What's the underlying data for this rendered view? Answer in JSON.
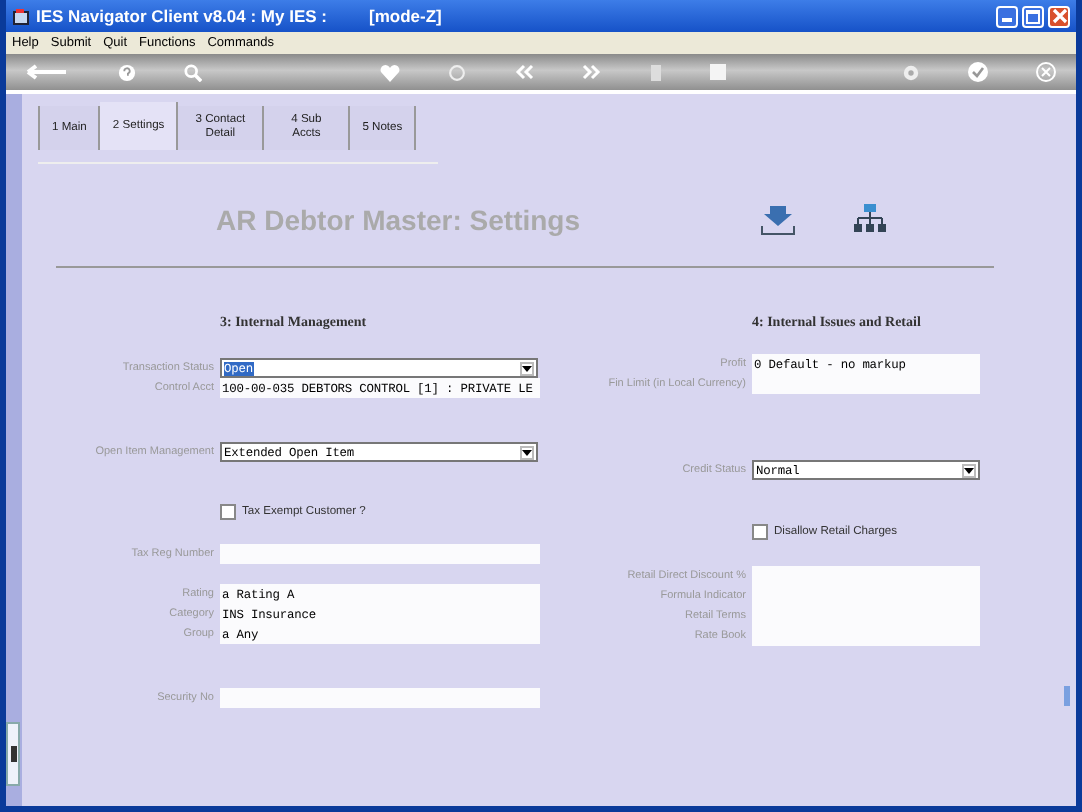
{
  "window": {
    "title": "IES Navigator Client v8.04 : My IES :",
    "mode": "[mode-Z]"
  },
  "menu": [
    "Help",
    "Submit",
    "Quit",
    "Functions",
    "Commands"
  ],
  "tabs": [
    {
      "label": "1 Main",
      "selected": false
    },
    {
      "label": "2 Settings",
      "selected": true
    },
    {
      "label": "3 Contact Detail",
      "selected": false
    },
    {
      "label": "4 Sub Accts",
      "selected": false
    },
    {
      "label": "5 Notes",
      "selected": false
    }
  ],
  "page_title": "AR Debtor Master: Settings",
  "sections": [
    {
      "heading": "3: Internal Management",
      "groups": [
        [
          {
            "kind": "select",
            "label": "Transaction Status",
            "value": "Open",
            "focused": true
          },
          {
            "kind": "text",
            "label": "Control Acct",
            "value": "100-00-035 DEBTORS CONTROL [1] : PRIVATE LE"
          }
        ],
        [
          {
            "kind": "select",
            "label": "Open Item Management",
            "value": "Extended Open Item",
            "focused": false
          }
        ],
        [
          {
            "kind": "checkbox",
            "label": "Tax Exempt Customer ?",
            "checked": false
          }
        ],
        [
          {
            "kind": "text",
            "label": "Tax Reg Number"
          }
        ],
        [
          {
            "kind": "text",
            "label": "Rating",
            "value": "a Rating A"
          },
          {
            "kind": "text",
            "label": "Category",
            "value": "INS Insurance"
          },
          {
            "kind": "text",
            "label": "Group",
            "value": "a Any"
          }
        ],
        [
          {
            "kind": "text",
            "label": "Security No"
          }
        ]
      ]
    },
    {
      "heading": "4: Internal Issues and Retail",
      "groups": [
        [
          {
            "kind": "text",
            "label": "Profit",
            "value": "0 Default - no markup"
          },
          {
            "kind": "text",
            "label": "Fin Limit (in Local Currency)"
          }
        ],
        [
          {
            "kind": "select",
            "label": "Credit Status",
            "value": "Normal",
            "focused": false
          }
        ],
        [
          {
            "kind": "checkbox",
            "label": "Disallow Retail Charges",
            "checked": false
          }
        ],
        [
          {
            "kind": "text",
            "label": "Retail Direct Discount %"
          },
          {
            "kind": "text",
            "label": "Formula Indicator"
          },
          {
            "kind": "text",
            "label": "Retail Terms"
          },
          {
            "kind": "text",
            "label": "Rate Book"
          }
        ]
      ]
    }
  ]
}
